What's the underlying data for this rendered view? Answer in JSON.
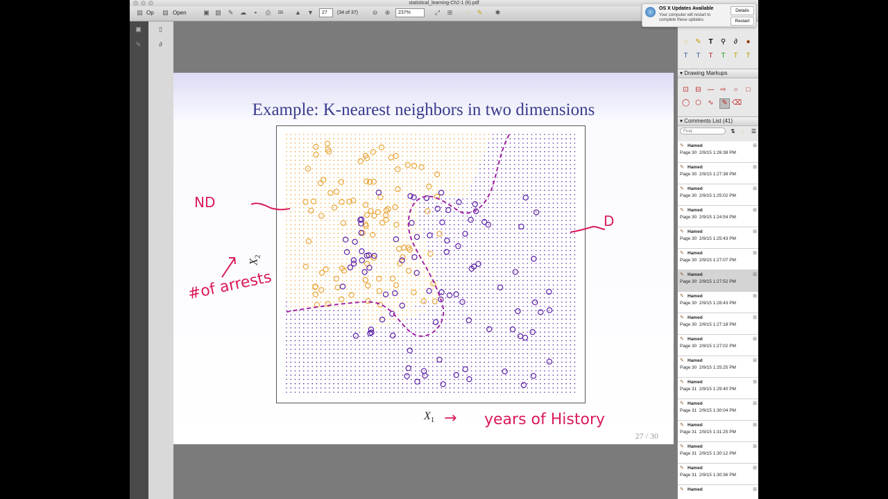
{
  "window": {
    "title": "statistical_learning-Ch2-1 (6).pdf"
  },
  "toolbar": {
    "open_label_partial": "Op",
    "open_label": "Open",
    "page_number": "27",
    "page_of": "(34 of 37)",
    "zoom": "237%"
  },
  "notification": {
    "title": "OS X Updates Available",
    "body": "Your computer will restart to complete these updates.",
    "details_label": "Details",
    "restart_label": "Restart"
  },
  "slide": {
    "title": "Example: K-nearest neighbors in two dimensions",
    "page_label": "27 / 30",
    "x_axis": "X",
    "x_sub": "1",
    "y_axis": "X",
    "y_sub": "2"
  },
  "annotations": {
    "nd": "ND",
    "d": "D",
    "y_note": "#of arrests",
    "x_note": "years of History",
    "arrow": "→"
  },
  "panel": {
    "drawing_markups": "Drawing Markups",
    "comments_list": "Comments List (41)",
    "find_placeholder": "Find"
  },
  "comments": [
    {
      "author": "Hamed",
      "page": "Page 30",
      "date": "2/9/15 1:26:38 PM"
    },
    {
      "author": "Hamed",
      "page": "Page 30",
      "date": "2/9/15 1:27:38 PM"
    },
    {
      "author": "Hamed",
      "page": "Page 30",
      "date": "2/9/15 1:25:02 PM"
    },
    {
      "author": "Hamed",
      "page": "Page 30",
      "date": "2/9/15 1:24:54 PM"
    },
    {
      "author": "Hamed",
      "page": "Page 30",
      "date": "2/9/15 1:25:43 PM"
    },
    {
      "author": "Hamed",
      "page": "Page 30",
      "date": "2/9/15 1:27:07 PM"
    },
    {
      "author": "Hamed",
      "page": "Page 30",
      "date": "2/9/15 1:27:52 PM",
      "selected": true
    },
    {
      "author": "Hamed",
      "page": "Page 30",
      "date": "2/9/15 1:28:43 PM"
    },
    {
      "author": "Hamed",
      "page": "Page 30",
      "date": "2/9/15 1:27:18 PM"
    },
    {
      "author": "Hamed",
      "page": "Page 30",
      "date": "2/9/15 1:27:02 PM"
    },
    {
      "author": "Hamed",
      "page": "Page 30",
      "date": "2/9/15 1:25:25 PM"
    },
    {
      "author": "Hamed",
      "page": "Page 31",
      "date": "2/9/15 1:29:40 PM"
    },
    {
      "author": "Hamed",
      "page": "Page 31",
      "date": "2/9/15 1:30:04 PM"
    },
    {
      "author": "Hamed",
      "page": "Page 31",
      "date": "2/9/15 1:31:25 PM"
    },
    {
      "author": "Hamed",
      "page": "Page 31",
      "date": "2/9/15 1:30:12 PM"
    },
    {
      "author": "Hamed",
      "page": "Page 31",
      "date": "2/9/15 1:30:36 PM"
    },
    {
      "author": "Hamed",
      "page": "",
      "date": ""
    }
  ],
  "colors": {
    "orange": "#e8a63a",
    "purple": "#5a1fa6",
    "ink": "#d91a5a"
  },
  "icons": [
    "folder-icon",
    "print-icon",
    "zoom-in-icon",
    "zoom-out-icon",
    "comment-icon",
    "pencil-icon"
  ]
}
